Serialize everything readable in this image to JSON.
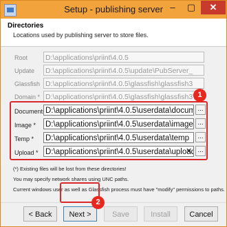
{
  "window": {
    "title": "Setup - publishing server",
    "minimize_glyph": "–",
    "maximize_glyph": "▢",
    "close_glyph": "✕"
  },
  "header": {
    "title": "Directories",
    "subtitle": "Locations used by publishing server to store files."
  },
  "fields": {
    "root": {
      "label": "Root",
      "value": "D:\\applications\\priint\\4.0.5"
    },
    "update": {
      "label": "Update",
      "value": "D:\\applications\\priint\\4.0.5\\update\\PubServer_"
    },
    "glassfish": {
      "label": "Glassfish",
      "value": "D:\\applications\\priint\\4.0.5\\glassfish\\glassfish3"
    },
    "domain": {
      "label": "Domain *",
      "value": "D:\\applications\\priint\\4.0.5\\glassfish\\glassfish3\\"
    },
    "documents": {
      "label": "Documents *",
      "value": "D:\\applications\\priint\\4.0.5\\userdata\\documents"
    },
    "image": {
      "label": "Image *",
      "value": "D:\\applications\\priint\\4.0.5\\userdata\\images"
    },
    "temp": {
      "label": "Temp *",
      "value": "D:\\applications\\priint\\4.0.5\\userdata\\temp"
    },
    "upload": {
      "label": "Upload *",
      "value": "D:\\applications\\priint\\4.0.5\\userdata\\upload"
    }
  },
  "browse_label": "...",
  "clear_glyph": "✕",
  "notes": [
    "(*) Existing files will be lost from these directories!",
    "You may specify network shares using UNC paths.",
    "Current windows user as well as Glassfish process must have \"modify\" permissions to paths."
  ],
  "annotations": {
    "badge1": "1",
    "badge2": "2",
    "highlight_color": "#d8262a"
  },
  "buttons": {
    "back": "< Back",
    "next": "Next >",
    "save": "Save",
    "install": "Install",
    "cancel": "Cancel"
  }
}
